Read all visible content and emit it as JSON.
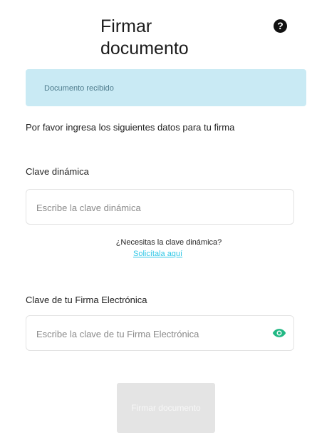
{
  "header": {
    "title": "Firmar documento",
    "help_icon": "question-circle-icon"
  },
  "alert": {
    "message": "Documento recibido",
    "color": "#c9eaf4"
  },
  "intro_text": "Por favor ingresa los siguientes datos para tu firma",
  "dynamic_key": {
    "label": "Clave dinámica",
    "placeholder": "Escribe la clave dinámica",
    "value": "",
    "help_question": "¿Necesitas la clave dinámica?",
    "help_link": "Solicítala aquí"
  },
  "signature_key": {
    "label": "Clave de tu Firma Electrónica",
    "placeholder": "Escribe la clave de tu Firma Electrónica",
    "value": "",
    "toggle_icon": "eye-icon",
    "accent_color": "#22b884"
  },
  "submit": {
    "label": "Firmar documento",
    "disabled": true
  }
}
